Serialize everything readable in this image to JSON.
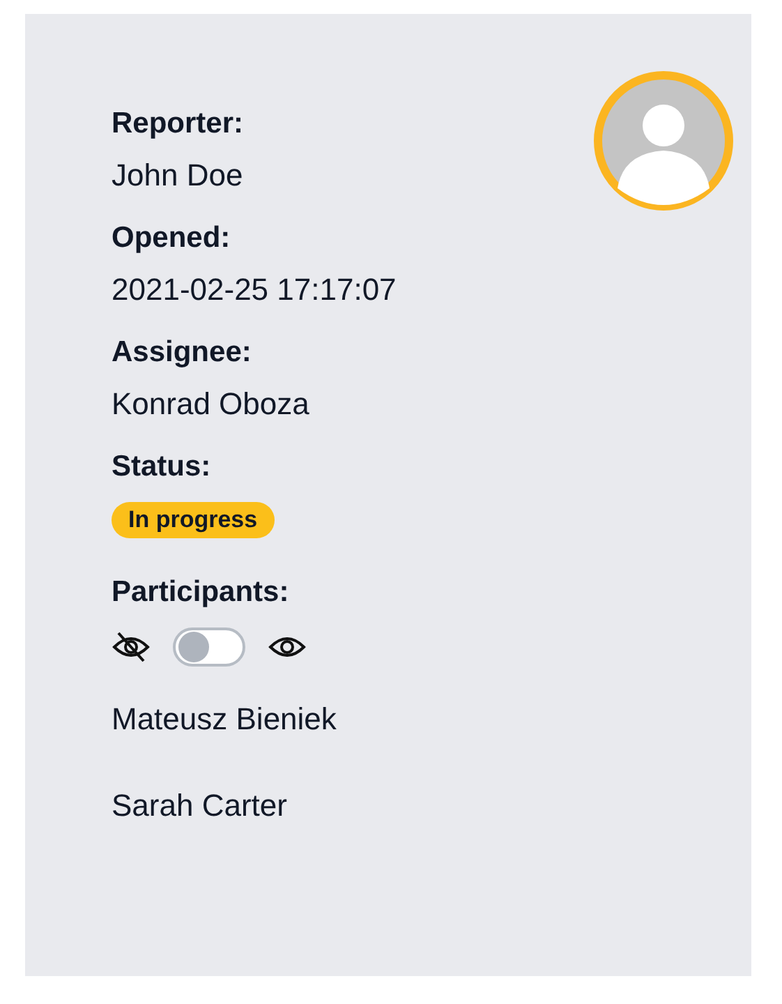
{
  "fields": [
    {
      "label": "Reporter:",
      "value": "John Doe"
    },
    {
      "label": "Opened:",
      "value": "2021-02-25 17:17:07"
    },
    {
      "label": "Assignee:",
      "value": "Konrad Oboza"
    }
  ],
  "status": {
    "label": "Status:",
    "badge": "In progress"
  },
  "participants": {
    "label": "Participants:",
    "visibility_toggle": {
      "on": false
    },
    "names": [
      "Mateusz Bieniek",
      "Sarah Carter"
    ]
  }
}
